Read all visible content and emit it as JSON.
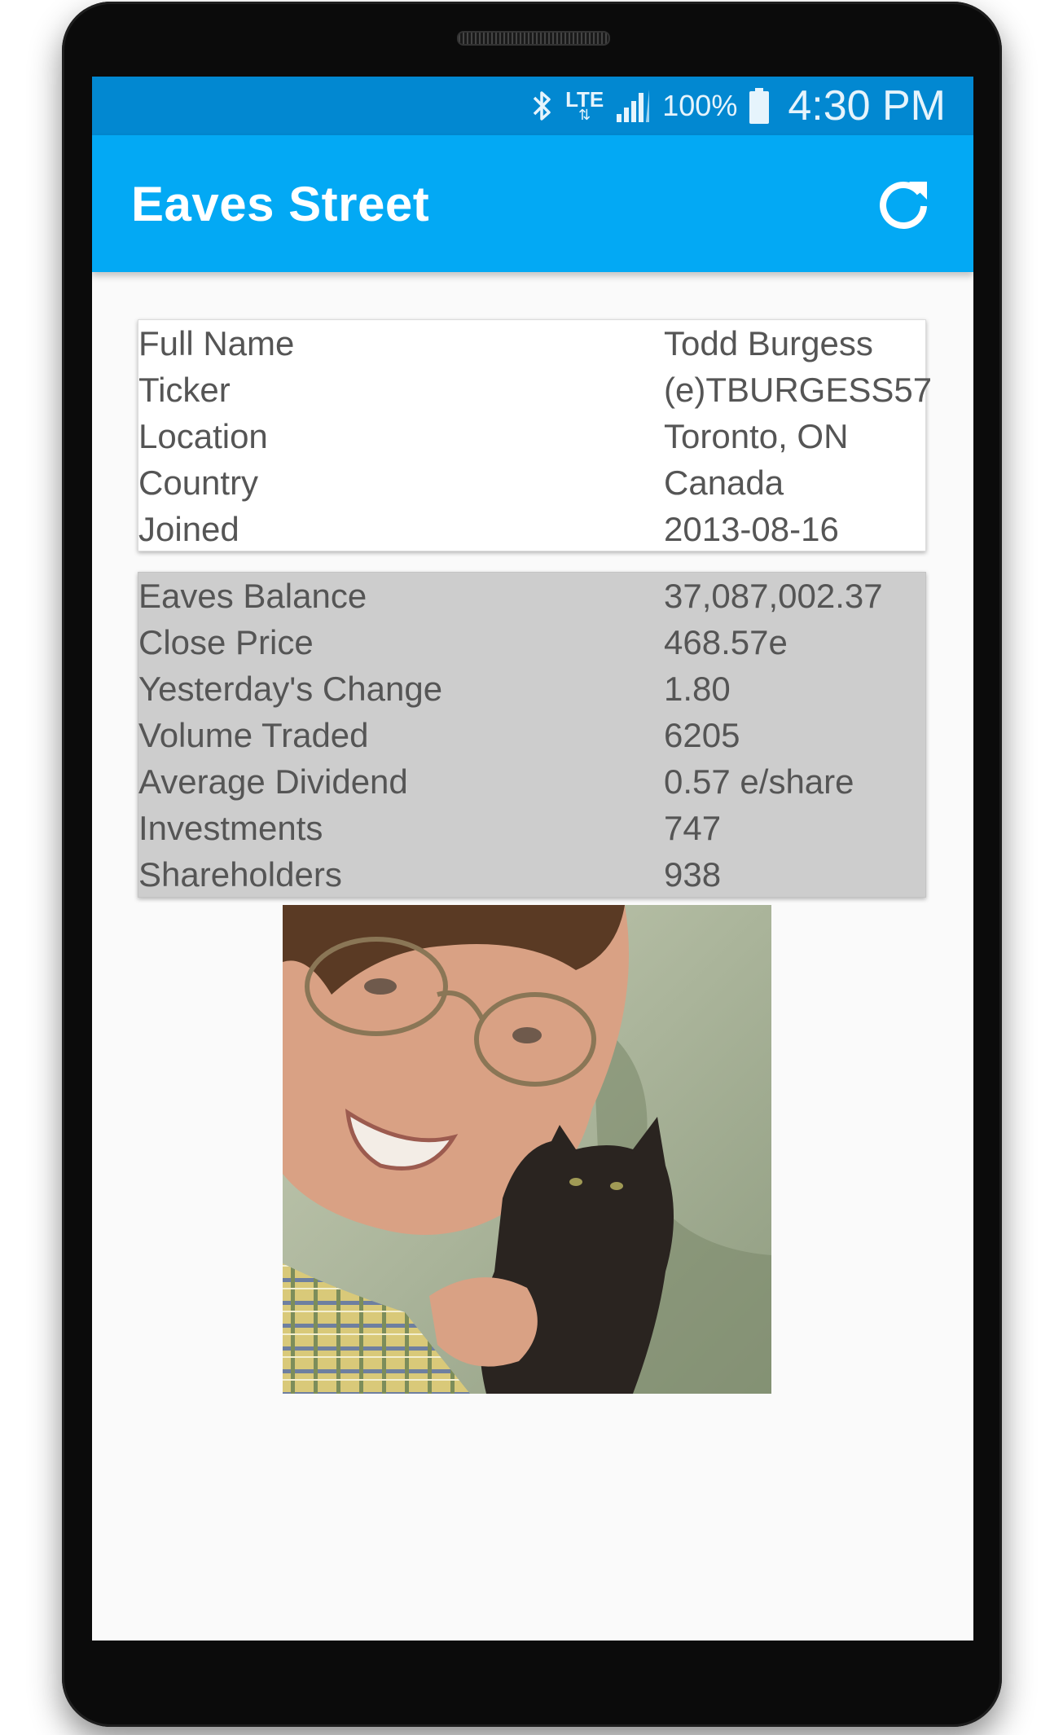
{
  "status_bar": {
    "network": "LTE",
    "battery_percent": "100%",
    "time": "4:30 PM",
    "icons": [
      "bluetooth-icon",
      "lte-data-icon",
      "signal-icon",
      "battery-icon"
    ]
  },
  "app_bar": {
    "title": "Eaves Street",
    "refresh_icon": "refresh-icon",
    "color": "#03a9f4"
  },
  "profile": {
    "rows": [
      {
        "label": "Full Name",
        "value": "Todd Burgess"
      },
      {
        "label": "Ticker",
        "value": "(e)TBURGESS57"
      },
      {
        "label": "Location",
        "value": "Toronto, ON"
      },
      {
        "label": "Country",
        "value": "Canada"
      },
      {
        "label": "Joined",
        "value": "2013-08-16"
      }
    ]
  },
  "stats": {
    "rows": [
      {
        "label": "Eaves Balance",
        "value": "37,087,002.37"
      },
      {
        "label": "Close Price",
        "value": "468.57e"
      },
      {
        "label": "Yesterday's Change",
        "value": "1.80"
      },
      {
        "label": "Volume Traded",
        "value": "6205"
      },
      {
        "label": "Average Dividend",
        "value": "0.57 e/share"
      },
      {
        "label": "Investments",
        "value": "747"
      },
      {
        "label": "Shareholders",
        "value": "938"
      }
    ]
  },
  "colors": {
    "status_bar": "#0288d1",
    "app_bar": "#03a9f4",
    "stats_card": "#cdcdcd",
    "text": "#555555"
  }
}
